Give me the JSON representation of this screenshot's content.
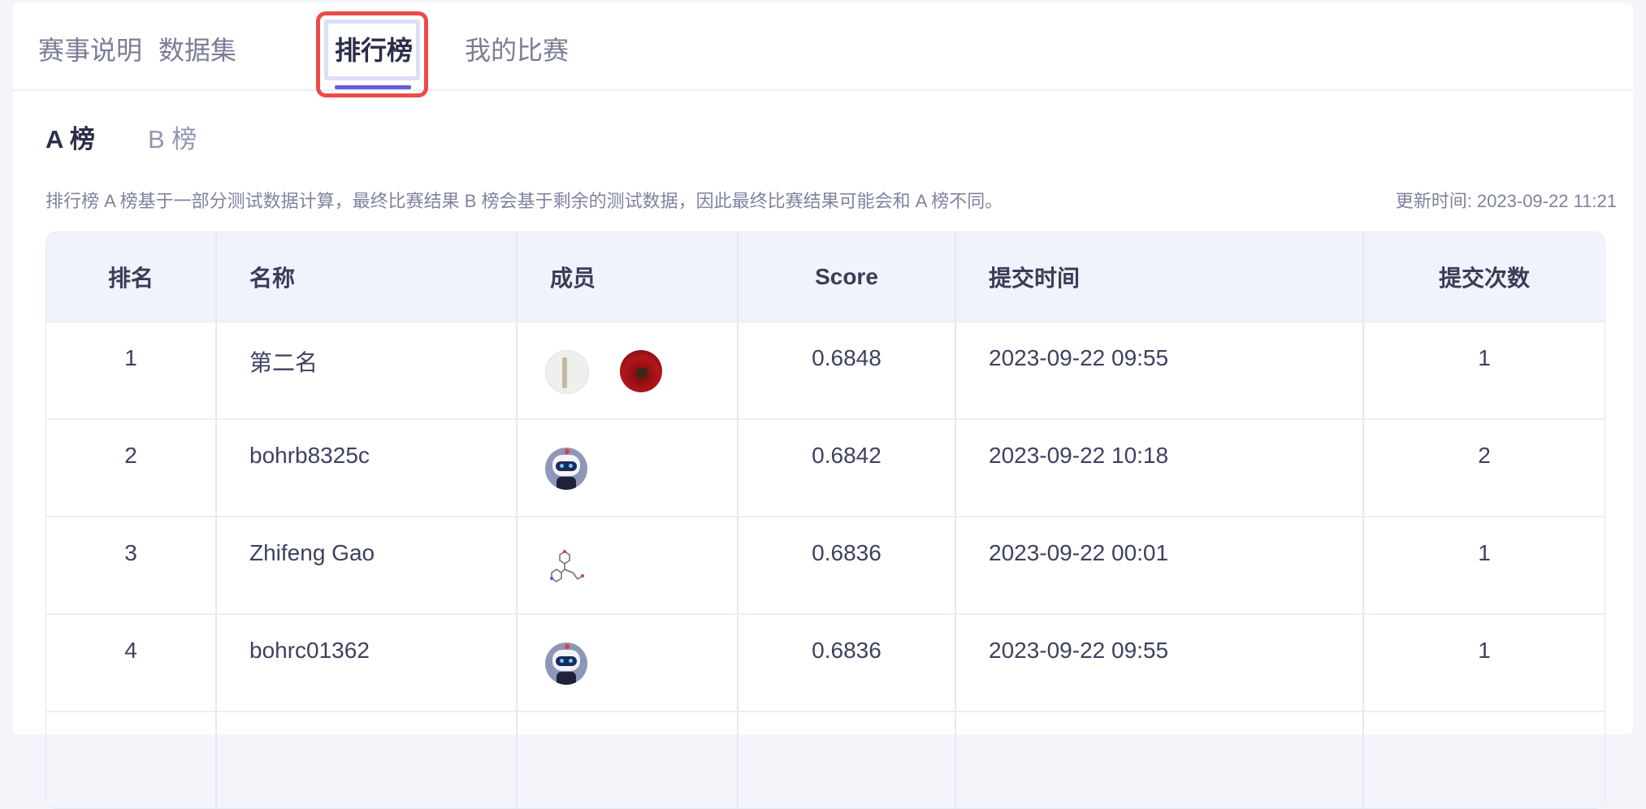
{
  "tabs": [
    {
      "label": "赛事说明"
    },
    {
      "label": "数据集"
    },
    {
      "label": "排行榜"
    },
    {
      "label": "我的比赛"
    }
  ],
  "active_tab": "排行榜",
  "subtabs": [
    {
      "label": "A 榜"
    },
    {
      "label": "B 榜"
    }
  ],
  "active_subtab": "A 榜",
  "notice": "排行榜 A 榜基于一部分测试数据计算，最终比赛结果 B 榜会基于剩余的测试数据，因此最终比赛结果可能会和 A 榜不同。",
  "update_time": "更新时间: 2023-09-22 11:21",
  "table": {
    "headers": [
      "排名",
      "名称",
      "成员",
      "Score",
      "提交时间",
      "提交次数"
    ],
    "rows": [
      {
        "rank": "1",
        "name": "第二名",
        "avatars": [
          "light-avatar",
          "red-avatar"
        ],
        "score": "0.6848",
        "time": "2023-09-22 09:55",
        "count": "1"
      },
      {
        "rank": "2",
        "name": "bohrb8325c",
        "avatars": [
          "robot-avatar"
        ],
        "score": "0.6842",
        "time": "2023-09-22 10:18",
        "count": "2"
      },
      {
        "rank": "3",
        "name": "Zhifeng Gao",
        "avatars": [
          "molecule-avatar"
        ],
        "score": "0.6836",
        "time": "2023-09-22 00:01",
        "count": "1"
      },
      {
        "rank": "4",
        "name": "bohrc01362",
        "avatars": [
          "robot-avatar"
        ],
        "score": "0.6836",
        "time": "2023-09-22 09:55",
        "count": "1"
      }
    ]
  },
  "colors": {
    "accent": "#6b5bd6",
    "highlight": "#ef4a4a",
    "header_bg": "#f1f3fc"
  }
}
